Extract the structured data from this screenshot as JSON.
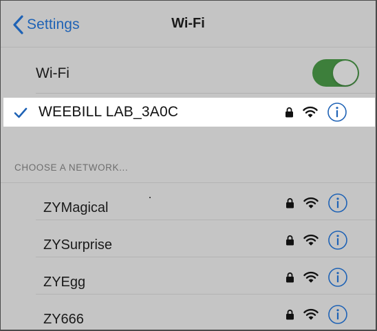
{
  "navbar": {
    "back_label": "Settings",
    "title": "Wi-Fi"
  },
  "wifi_toggle": {
    "label": "Wi-Fi",
    "on": true
  },
  "connected_network": {
    "name": "WEEBILL LAB_3A0C",
    "secured": true,
    "connected": true
  },
  "section": {
    "header": "CHOOSE A NETWORK..."
  },
  "networks": [
    {
      "name": "ZYMagical",
      "secured": true
    },
    {
      "name": "ZYSurprise",
      "secured": true
    },
    {
      "name": "ZYEgg",
      "secured": true
    },
    {
      "name": "ZY666",
      "secured": true
    }
  ],
  "icons": {
    "back": "chevron-left-icon",
    "check": "checkmark-icon",
    "lock": "lock-icon",
    "wifi": "wifi-signal-icon",
    "info": "info-icon"
  },
  "colors": {
    "accent": "#1e62b5",
    "toggle_on": "#3d7f3b",
    "background_dimmed": "#c5c5c5",
    "highlight_row": "#ffffff"
  }
}
